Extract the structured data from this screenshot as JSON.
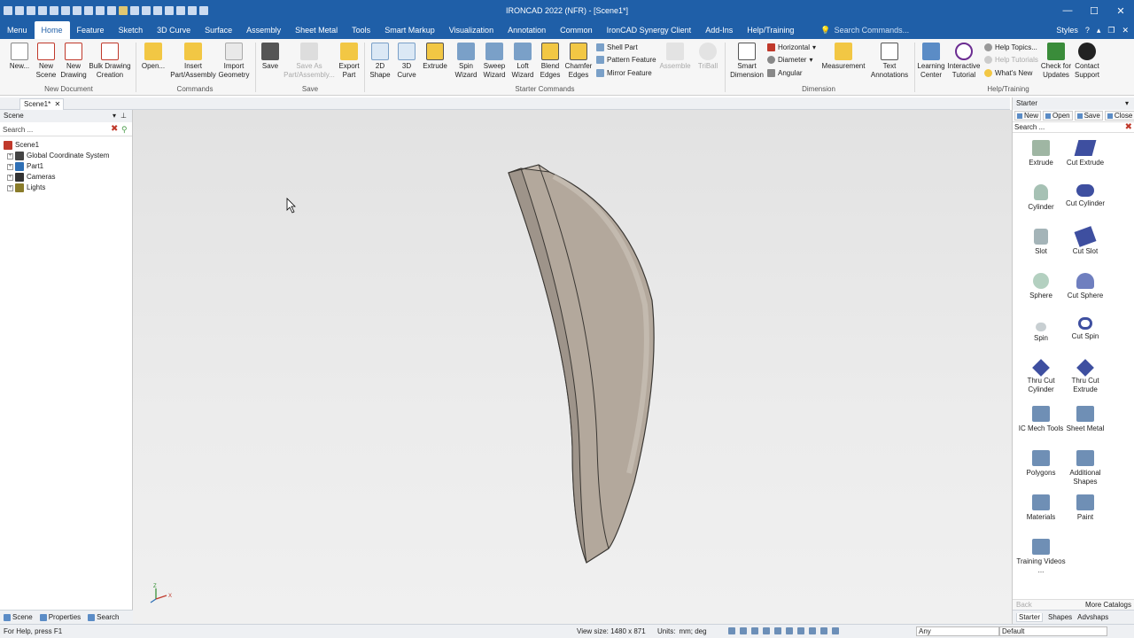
{
  "app": {
    "title": "IRONCAD 2022 (NFR) - [Scene1*]"
  },
  "window_buttons": {
    "minimize": "—",
    "maximize": "☐",
    "close": "✕"
  },
  "menu": {
    "tabs": [
      "Menu",
      "Home",
      "Feature",
      "Sketch",
      "3D Curve",
      "Surface",
      "Assembly",
      "Sheet Metal",
      "Tools",
      "Smart Markup",
      "Visualization",
      "Annotation",
      "Common",
      "IronCAD Synergy Client",
      "Add-Ins",
      "Help/Training"
    ],
    "active_tab": "Home",
    "search_placeholder": "Search Commands...",
    "styles_label": "Styles"
  },
  "ribbon": {
    "new_label": "New...",
    "new_scene_label": "New Scene",
    "new_drawing_label": "New Drawing",
    "bulk_drawing_label": "Bulk Drawing Creation",
    "group_new_document": "New Document",
    "open_label": "Open...",
    "insert_label": "Insert Part/Assembly",
    "import_label": "Import Geometry",
    "group_commands": "Commands",
    "save_label": "Save",
    "save_as_label": "Save As Part/Assembly...",
    "export_label": "Export Part",
    "group_save": "Save",
    "shape2d_label": "2D Shape",
    "curve3d_label": "3D Curve",
    "extrude_label": "Extrude",
    "spin_label": "Spin Wizard",
    "sweep_label": "Sweep Wizard",
    "loft_label": "Loft Wizard",
    "blend_label": "Blend Edges",
    "chamfer_label": "Chamfer Edges",
    "shell_label": "Shell Part",
    "pattern_label": "Pattern Feature",
    "mirror_label": "Mirror Feature",
    "assemble_label": "Assemble",
    "triball_label": "TriBall",
    "group_starter": "Starter Commands",
    "smart_dim_label": "Smart Dimension",
    "horizontal_label": "Horizontal",
    "diameter_label": "Diameter",
    "angular_label": "Angular",
    "measurement_label": "Measurement",
    "text_annot_label": "Text Annotations",
    "group_dimension": "Dimension",
    "learning_label": "Learning Center",
    "tutorial_label": "Interactive Tutorial",
    "help_topics_label": "Help Topics...",
    "help_tutorials_label": "Help Tutorials",
    "whats_new_label": "What's New",
    "updates_label": "Check for Updates",
    "contact_label": "Contact Support",
    "group_help": "Help/Training"
  },
  "doc_tab": {
    "label": "Scene1*",
    "close": "✕"
  },
  "scene_panel": {
    "title": "Scene",
    "search_placeholder": "Search ...",
    "tree": [
      "Scene1",
      "Global Coordinate System",
      "Part1",
      "Cameras",
      "Lights"
    ],
    "bottom_tabs": [
      "Scene",
      "Properties",
      "Search"
    ]
  },
  "viewport": {
    "axis_z": "Z",
    "axis_x": "X"
  },
  "catalog_panel": {
    "title": "Starter",
    "toolbar": [
      "New",
      "Open",
      "Save",
      "Close"
    ],
    "search_placeholder": "Search ...",
    "items": [
      "Extrude",
      "Cut Extrude",
      "Cylinder",
      "Cut Cylinder",
      "Slot",
      "Cut Slot",
      "Sphere",
      "Cut Sphere",
      "Spin",
      "Cut Spin",
      "Thru Cut Cylinder",
      "Thru Cut Extrude",
      "IC Mech Tools",
      "Sheet Metal",
      "Polygons",
      "Additional Shapes",
      "Materials",
      "Paint",
      "Training Videos ..."
    ],
    "back_label": "Back",
    "more_label": "More Catalogs",
    "bottom_tabs": [
      "Starter",
      "Shapes",
      "Advshaps"
    ]
  },
  "status": {
    "help": "For Help, press F1",
    "view_size": "View size: 1480 x 871",
    "units_label": "Units:",
    "units_value": "mm; deg",
    "filter_value": "Any",
    "material_value": "Default"
  },
  "colors": {
    "title_blue": "#1f5fa8",
    "part_fill": "#b3a89c",
    "part_edge": "#3a3733"
  }
}
